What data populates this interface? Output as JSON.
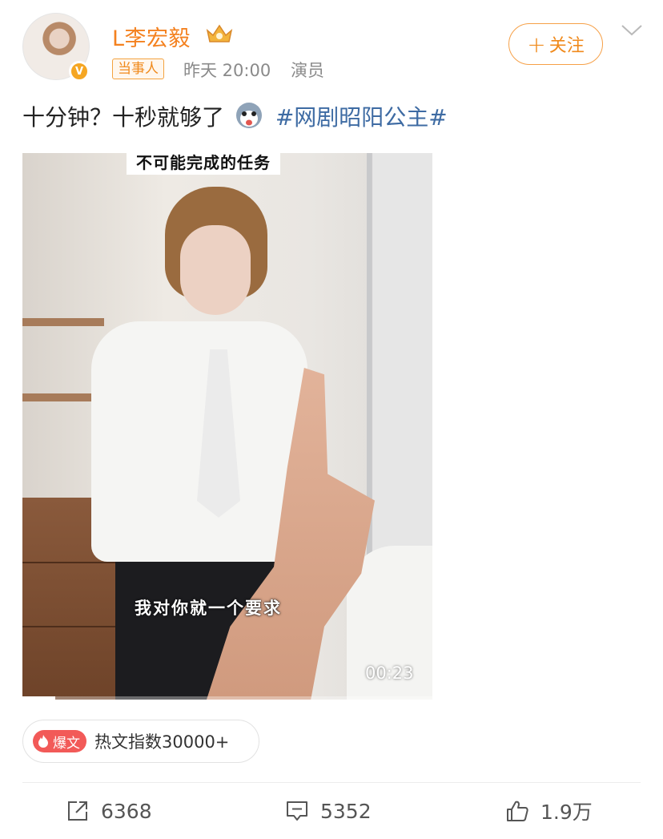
{
  "user": {
    "name": "L李宏毅",
    "verified_badge": "V",
    "role_tag": "当事人",
    "time": "昨天 20:00",
    "source": "演员",
    "follow_label": "关注"
  },
  "post": {
    "text": "十分钟？十秒就够了",
    "topic": "#网剧昭阳公主#"
  },
  "video": {
    "caption_top": "不可能完成的任务",
    "subtitle": "我对你就一个要求",
    "duration": "00:23",
    "progress": 0.08
  },
  "hot": {
    "badge": "爆文",
    "text": "热文指数30000+"
  },
  "actions": {
    "repost": "6368",
    "comment": "5352",
    "like": "1.9万"
  },
  "colors": {
    "brand_orange": "#f4811f",
    "topic_blue": "#3e6ba3",
    "hot_red": "#f25a58"
  }
}
